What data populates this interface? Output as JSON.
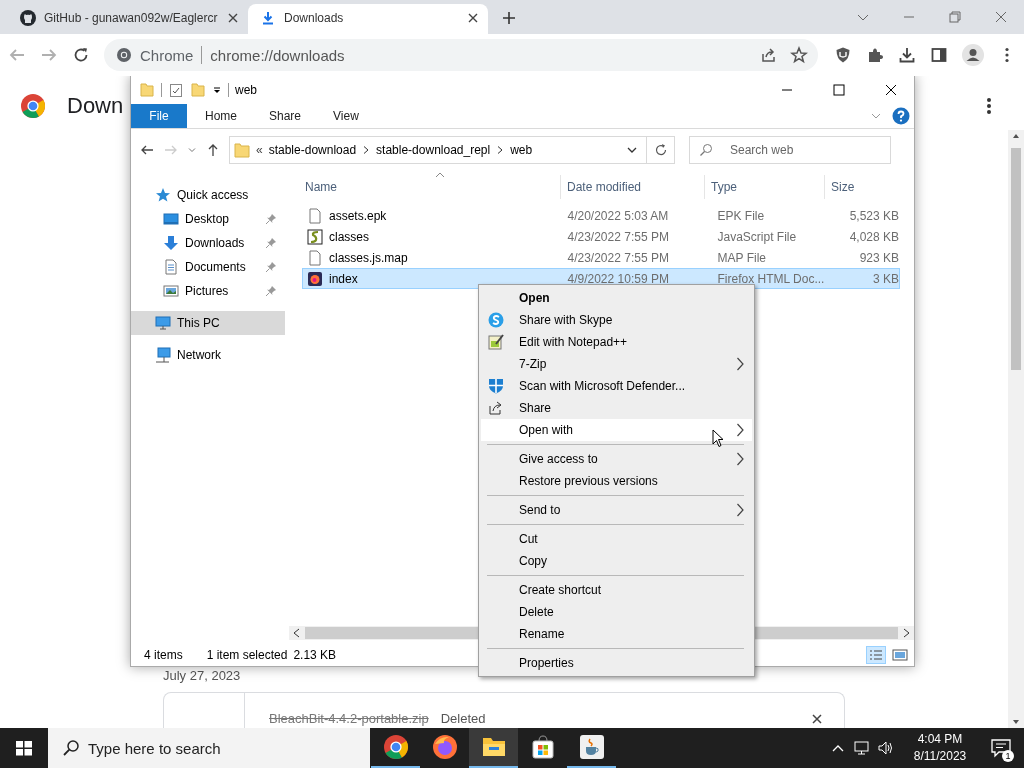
{
  "browser": {
    "tabs": [
      {
        "title": "GitHub - gunawan092w/Eaglercr",
        "kind": "github",
        "selected": false
      },
      {
        "title": "Downloads",
        "kind": "download",
        "selected": true
      }
    ],
    "omnibox": {
      "chip": "Chrome",
      "url": "chrome://downloads"
    }
  },
  "downloads_page": {
    "title": "Down",
    "date": "July 27, 2023",
    "items": [
      {
        "name": "BleachBit-4.4.2-portable.zip",
        "status": "Deleted",
        "deleted": true
      }
    ]
  },
  "explorer": {
    "title": "web",
    "ribbon_tabs": [
      {
        "label": "File",
        "selected": true
      },
      {
        "label": "Home",
        "selected": false
      },
      {
        "label": "Share",
        "selected": false
      },
      {
        "label": "View",
        "selected": false
      }
    ],
    "address": {
      "overflow": "«",
      "crumbs": [
        "stable-download",
        "stable-download_repl",
        "web"
      ]
    },
    "search": {
      "placeholder": "Search web"
    },
    "columns": [
      "Name",
      "Date modified",
      "Type",
      "Size"
    ],
    "sidebar": [
      {
        "label": "Quick access",
        "kind": "star",
        "selected": false,
        "children": [
          {
            "label": "Desktop",
            "kind": "desktop",
            "pinned": true,
            "selected": false
          },
          {
            "label": "Downloads",
            "kind": "downloads",
            "pinned": true,
            "selected": false
          },
          {
            "label": "Documents",
            "kind": "documents",
            "pinned": true,
            "selected": false
          },
          {
            "label": "Pictures",
            "kind": "pictures",
            "pinned": true,
            "selected": false
          }
        ]
      },
      {
        "label": "This PC",
        "kind": "pc",
        "selected": true
      },
      {
        "label": "Network",
        "kind": "network",
        "selected": false
      }
    ],
    "files": [
      {
        "name": "assets.epk",
        "date": "4/20/2022 5:03 AM",
        "type": "EPK File",
        "size": "5,523 KB",
        "kind": "blank",
        "selected": false
      },
      {
        "name": "classes",
        "date": "4/23/2022 7:55 PM",
        "type": "JavaScript File",
        "size": "4,028 KB",
        "kind": "script",
        "selected": false
      },
      {
        "name": "classes.js.map",
        "date": "4/23/2022 7:55 PM",
        "type": "MAP File",
        "size": "923 KB",
        "kind": "blank",
        "selected": false
      },
      {
        "name": "index",
        "date": "4/9/2022 10:59 PM",
        "type": "Firefox HTML Doc...",
        "size": "3 KB",
        "kind": "firefox",
        "selected": true
      }
    ],
    "status": {
      "count": "4 items",
      "selection": "1 item selected",
      "selection_size": "2.13 KB"
    }
  },
  "context_menu": {
    "items": [
      {
        "kind": "plain",
        "label": "Open",
        "default": true,
        "submenu": false,
        "selected": false
      },
      {
        "kind": "skype",
        "label": "Share with Skype",
        "default": false,
        "submenu": false,
        "selected": false
      },
      {
        "kind": "notepad",
        "label": "Edit with Notepad++",
        "default": false,
        "submenu": false,
        "selected": false
      },
      {
        "kind": "plain",
        "label": "7-Zip",
        "default": false,
        "submenu": true,
        "selected": false
      },
      {
        "kind": "defender",
        "label": "Scan with Microsoft Defender...",
        "default": false,
        "submenu": false,
        "selected": false
      },
      {
        "kind": "share",
        "label": "Share",
        "default": false,
        "submenu": false,
        "selected": false
      },
      {
        "kind": "plain",
        "label": "Open with",
        "default": false,
        "submenu": true,
        "selected": true
      },
      {
        "kind": "separator"
      },
      {
        "kind": "plain",
        "label": "Give access to",
        "default": false,
        "submenu": true,
        "selected": false
      },
      {
        "kind": "plain",
        "label": "Restore previous versions",
        "default": false,
        "submenu": false,
        "selected": false
      },
      {
        "kind": "separator"
      },
      {
        "kind": "plain",
        "label": "Send to",
        "default": false,
        "submenu": true,
        "selected": false
      },
      {
        "kind": "separator"
      },
      {
        "kind": "plain",
        "label": "Cut",
        "default": false,
        "submenu": false,
        "selected": false
      },
      {
        "kind": "plain",
        "label": "Copy",
        "default": false,
        "submenu": false,
        "selected": false
      },
      {
        "kind": "separator"
      },
      {
        "kind": "plain",
        "label": "Create shortcut",
        "default": false,
        "submenu": false,
        "selected": false
      },
      {
        "kind": "plain",
        "label": "Delete",
        "default": false,
        "submenu": false,
        "selected": false
      },
      {
        "kind": "plain",
        "label": "Rename",
        "default": false,
        "submenu": false,
        "selected": false
      },
      {
        "kind": "separator"
      },
      {
        "kind": "plain",
        "label": "Properties",
        "default": false,
        "submenu": false,
        "selected": false
      }
    ]
  },
  "taskbar": {
    "search": {
      "placeholder": "Type here to search"
    },
    "apps": [
      {
        "kind": "chrome",
        "running": true,
        "selected": false
      },
      {
        "kind": "firefox",
        "running": false,
        "selected": false
      },
      {
        "kind": "explorer",
        "running": true,
        "selected": true
      },
      {
        "kind": "store",
        "running": false,
        "selected": false
      },
      {
        "kind": "java",
        "running": true,
        "selected": false
      }
    ],
    "time": "4:04 PM",
    "date": "8/11/2023",
    "notifications": "1"
  }
}
